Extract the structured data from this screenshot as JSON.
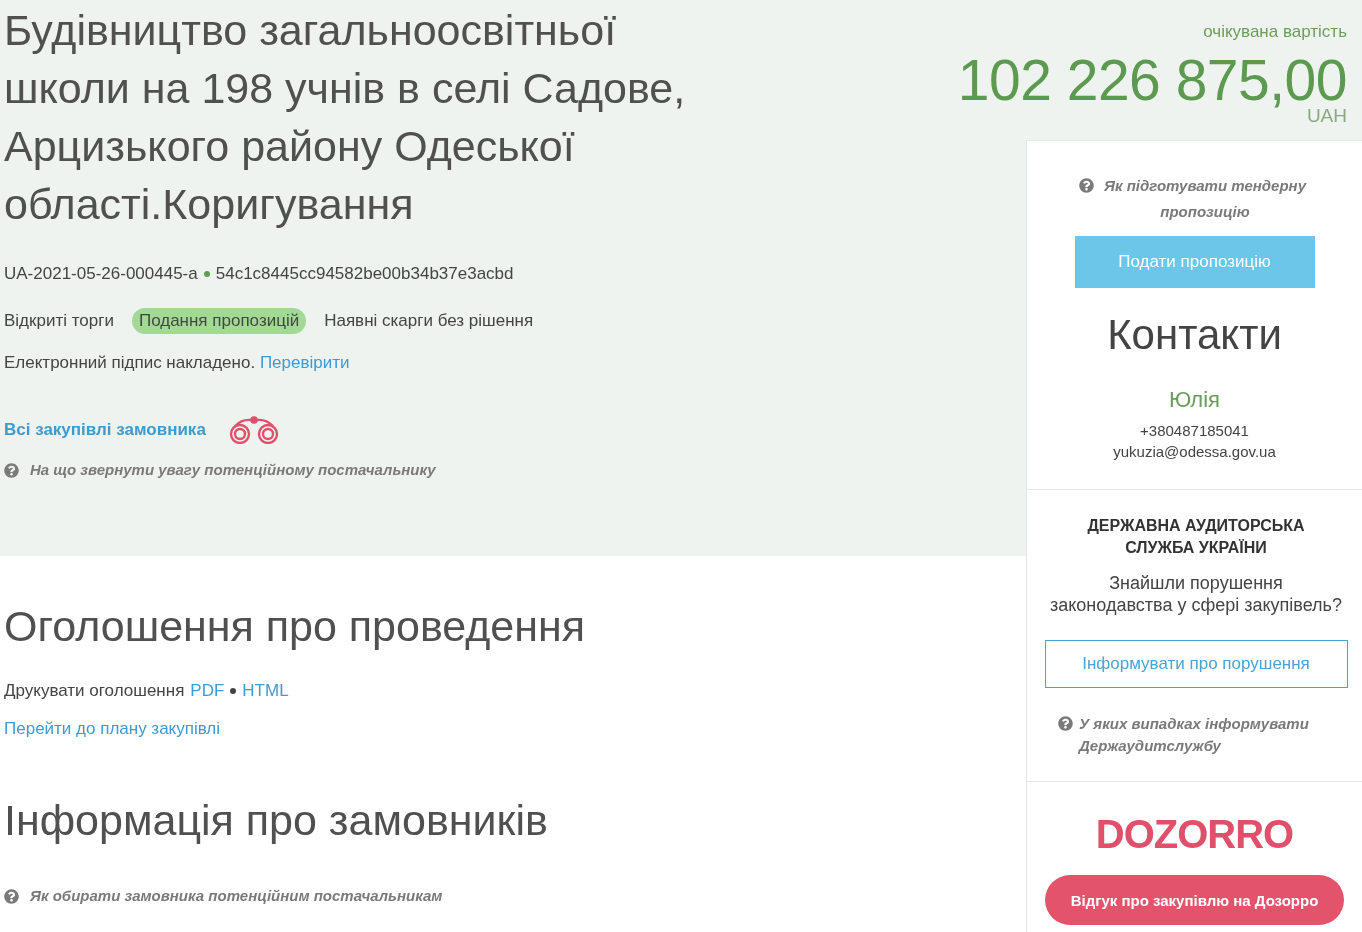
{
  "tender": {
    "title": "Будівництво загальноосвітньої школи на 198 учнів в селі Садове, Арцизького району Одеської області.Коригування",
    "tender_id": "UA-2021-05-26-000445-a",
    "hash": "54c1c8445cc94582be00b34b37e3acbd",
    "procedure_type": "Відкриті торги",
    "status_badge": "Подання пропозицій",
    "complaints_note": "Наявні скарги без рішення",
    "signature": {
      "text": "Електронний підпис накладено.",
      "link": "Перевірити"
    },
    "customer_link": "Всі закупівлі замовника",
    "hint": "На що звернути увагу потенційному постачальнику"
  },
  "expected_value": {
    "label": "очікувана вартість",
    "amount": "102 226 875,00",
    "currency": "UAH"
  },
  "announcement": {
    "heading": "Оголошення про проведення",
    "print_label": "Друкувати оголошення",
    "print_links": [
      "PDF",
      "HTML"
    ],
    "plan_link": "Перейти до плану закупівлі"
  },
  "customers": {
    "heading": "Інформація про замовників",
    "hint": "Як обирати замовника потенційним постачальникам"
  },
  "sidebar": {
    "bid_hint": "Як підготувати тендерну пропозицію",
    "bid_button": "Подати пропозицію",
    "contacts": {
      "heading": "Контакти",
      "name": "Юлія",
      "phone": "+380487185041",
      "email": "yukuzia@odessa.gov.ua"
    },
    "audit": {
      "title": "ДЕРЖАВНА АУДИТОРСЬКА СЛУЖБА УКРАЇНИ",
      "question": "Знайшли порушення законодавства у сфері закупівель?",
      "button": "Інформувати про порушення",
      "hint": "У яких випадках інформувати Держаудитслужбу"
    },
    "dozorro": {
      "logo": "DOZORRO",
      "button": "Відгук про закупівлю на Дозорро"
    }
  }
}
